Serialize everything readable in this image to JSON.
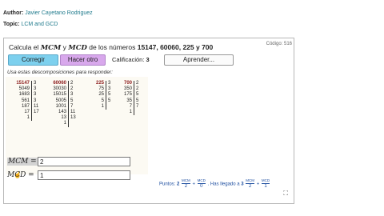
{
  "meta": {
    "author_label": "Author:",
    "author_name": "Javier Cayetano Rodriguez",
    "topic_label": "Topic:",
    "topic_name": "LCM and GCD"
  },
  "exercise": {
    "prompt_pre": "Calcula el",
    "mcm": "MCM",
    "y": "y",
    "mcd": "MCD",
    "prompt_mid": "de los números",
    "numbers": "15147, 60060, 225 y 700",
    "codigo": "Código: 516",
    "btn_check": "Corregir",
    "btn_again": "Hacer otro",
    "calif_label": "Calificación:",
    "calif_value": "3",
    "btn_learn": "Aprender...",
    "hint": "Usa estas descomposiciones para responder:"
  },
  "factorizations": [
    {
      "nums": [
        "15147",
        "5049",
        "1683",
        "561",
        "187",
        "17",
        "1"
      ],
      "divs": [
        "3",
        "3",
        "3",
        "3",
        "11",
        "17"
      ],
      "highlight_first": true
    },
    {
      "nums": [
        "60060",
        "30030",
        "15015",
        "5005",
        "1001",
        "143",
        "13",
        "1"
      ],
      "divs": [
        "2",
        "2",
        "3",
        "5",
        "7",
        "11",
        "13"
      ],
      "highlight_first": true
    },
    {
      "nums": [
        "225",
        "75",
        "25",
        "5",
        "1"
      ],
      "divs": [
        "3",
        "3",
        "5",
        "5"
      ],
      "highlight_first": true
    },
    {
      "nums": [
        "700",
        "350",
        "175",
        "35",
        "7",
        "1"
      ],
      "divs": [
        "2",
        "2",
        "5",
        "5",
        "7"
      ],
      "highlight_first": true
    }
  ],
  "answers": {
    "mcm_label": "MCM =",
    "mcm_value": "2",
    "mcd_label": "MCD =",
    "mcd_value": "1"
  },
  "points": {
    "label": "Puntos:",
    "value": "2",
    "f1_top": "MCM",
    "f1_bot": "2",
    "plus": "+",
    "f2_top": "MCD",
    "f2_bot": "0",
    "reached": ". Has llegado a",
    "reached_value": "3",
    "f3_top": "MCM",
    "f3_bot": "2",
    "f4_top": "MCD",
    "f4_bot": "1"
  },
  "icons": {
    "expand": "expand-icon",
    "cursor": "hand-cursor-icon"
  }
}
